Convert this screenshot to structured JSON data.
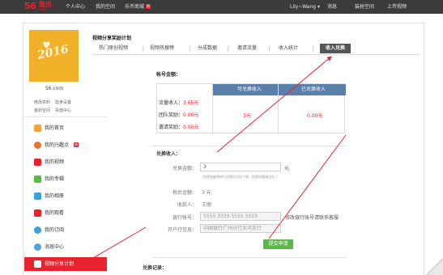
{
  "topbar": {
    "logo_num": "56",
    "logo_cn": "我乐",
    "logo_com": ".com",
    "links": [
      "个人中心",
      "我的空间",
      "乐币商城"
    ],
    "hot_badge": "热",
    "user": "Lily~Wang ▾",
    "message": "消息",
    "decorate": "装扮空间",
    "upload": "上传视频"
  },
  "sidebar": {
    "avatar_text": "2016",
    "username": "56.com",
    "links": [
      "修改资料",
      "隐身设置",
      "装扮空间",
      "充值中心"
    ],
    "items": [
      {
        "label": "我的首页",
        "icon": "home-icon",
        "color": "#f0a53a"
      },
      {
        "label": "我的兴趣点",
        "icon": "interest-icon",
        "color": "#e8732f",
        "badge": "热"
      },
      {
        "label": "我的视频",
        "icon": "video-icon",
        "color": "#e8232f"
      },
      {
        "label": "我的专辑",
        "icon": "album-icon",
        "color": "#58b947"
      },
      {
        "label": "我的相册",
        "icon": "photo-icon",
        "color": "#3ba0dc"
      },
      {
        "label": "我的观看",
        "icon": "history-icon",
        "color": "#e8232f"
      },
      {
        "label": "我的订阅",
        "icon": "subscribe-icon",
        "color": "#3ba0dc"
      },
      {
        "label": "消息中心",
        "icon": "message-icon",
        "color": "#4aa6d8"
      },
      {
        "label": "视频分享计划",
        "icon": "share-icon",
        "color": "#ffffff"
      }
    ],
    "colors": {
      "accent": "#e8232f"
    }
  },
  "main": {
    "title": "视频分享奖励计划",
    "tabs": [
      "热门原创视频",
      "视频热搜榜",
      "分成数据",
      "邀请流量",
      "收入统计",
      "收入兑换"
    ],
    "account_title": "帐号金额：",
    "table": {
      "headers": [
        "可兑换收入",
        "已兑换收入"
      ],
      "rows": [
        {
          "label": "流量收入：",
          "value": "3.65元"
        },
        {
          "label": "团队奖励：",
          "value": "0.00元"
        },
        {
          "label": "邀请奖励：",
          "value": "0.00元"
        }
      ],
      "redeemable": "3元",
      "redeemed": "0.00元"
    },
    "exchange_title": "兑换收入：",
    "form": {
      "amount_label": "兑换金额：",
      "amount_value": "3",
      "amount_unit": "元",
      "amount_hint": "（兑换金额将进行扣税后代扣个税，扣税详情请点击 ）",
      "after_tax_label": "税后金额：",
      "after_tax_value": "3 元",
      "payee_label": "收款人：",
      "payee_value": "王丽",
      "bank_account_label": "银行帐号：",
      "bank_account_value": "5555 3333 5555 3333",
      "bank_account_note": "修改银行账号请联系客服",
      "bank_branch_label": "开户行信息：",
      "bank_branch_value": "中国银行广州分行天河支行",
      "submit": "提交申请"
    },
    "records_title": "兑换记录："
  }
}
